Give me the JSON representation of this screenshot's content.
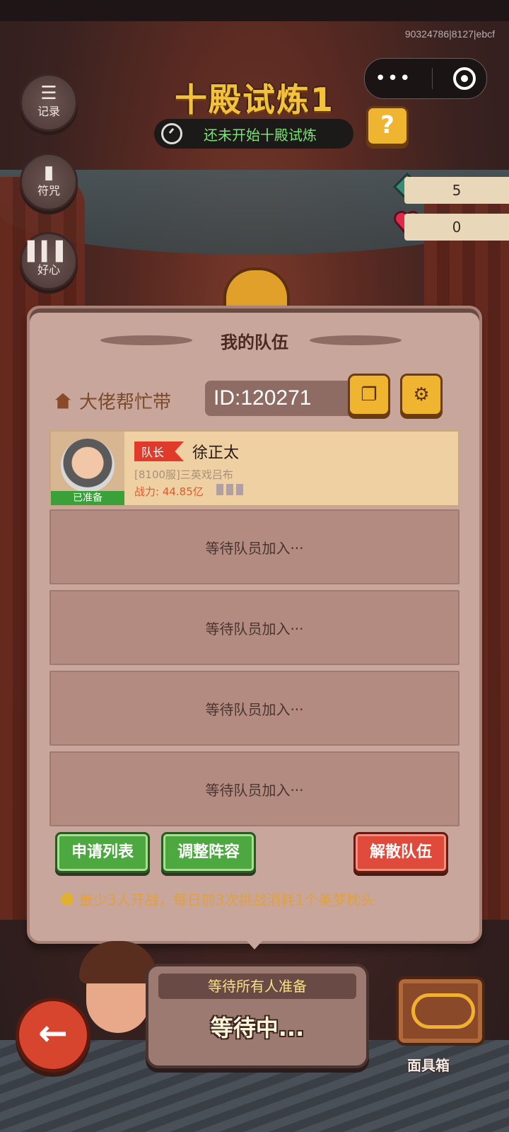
{
  "top": {
    "uid": "90324786|8127|ebcf"
  },
  "title": "十殿试炼1",
  "status_text": "还未开始十殿试炼",
  "help_label": "?",
  "side_buttons": [
    {
      "label": "记录",
      "icon": "list-icon"
    },
    {
      "label": "符咒",
      "icon": "talisman-icon"
    },
    {
      "label": "好心",
      "icon": "bars-icon"
    }
  ],
  "resources": [
    {
      "name": "pillow",
      "value": "5",
      "color": "#3a8a7a"
    },
    {
      "name": "heart",
      "value": "0",
      "color": "#e02a4a"
    }
  ],
  "panel": {
    "title": "我的队伍",
    "team_name": "大佬帮忙带",
    "team_id": "ID:120271",
    "member": {
      "ready_label": "已准备",
      "role": "队长",
      "name": "徐正太",
      "server": "[8100服]三英戏吕布",
      "power": "战力: 44.85亿"
    },
    "empty_slots": [
      "等待队员加入···",
      "等待队员加入···",
      "等待队员加入···",
      "等待队员加入···"
    ],
    "buttons": {
      "apply_list": "申请列表",
      "adjust_lineup": "调整阵容",
      "disband": "解散队伍"
    },
    "tip": "最少3人开战，每日前3次挑战消耗1个美梦枕头"
  },
  "wait": {
    "subtitle": "等待所有人准备",
    "status": "等待中..."
  },
  "chest_label": "面具箱",
  "colors": {
    "accent_gold": "#f4c23a",
    "ready_green": "#3aa03a",
    "danger_red": "#e04a3a",
    "panel_bg": "#c9a69c"
  }
}
